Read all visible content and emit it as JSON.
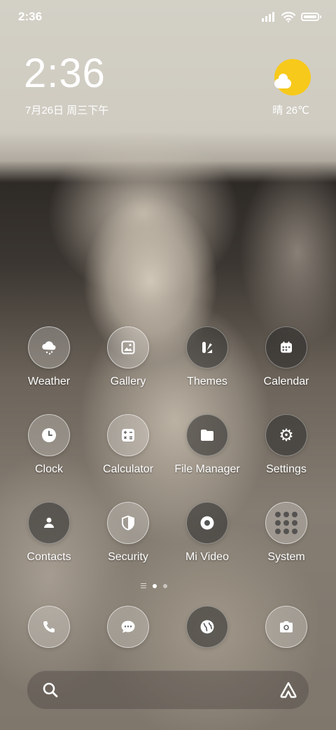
{
  "status_bar": {
    "time": "2:36"
  },
  "lock_widget": {
    "time": "2:36",
    "date": "7月26日 周三下午",
    "weather": "晴 26℃"
  },
  "apps": [
    {
      "label": "Weather",
      "icon": "weather-cloud-icon"
    },
    {
      "label": "Gallery",
      "icon": "gallery-icon"
    },
    {
      "label": "Themes",
      "icon": "themes-icon"
    },
    {
      "label": "Calendar",
      "icon": "calendar-icon"
    },
    {
      "label": "Clock",
      "icon": "clock-icon"
    },
    {
      "label": "Calculator",
      "icon": "calculator-icon"
    },
    {
      "label": "File Manager",
      "icon": "folder-icon"
    },
    {
      "label": "Settings",
      "icon": "gear-icon"
    },
    {
      "label": "Contacts",
      "icon": "contacts-icon"
    },
    {
      "label": "Security",
      "icon": "shield-icon"
    },
    {
      "label": "Mi Video",
      "icon": "video-play-icon"
    },
    {
      "label": "System",
      "icon": "folder-grid-icon"
    }
  ],
  "dock": [
    {
      "icon": "phone-icon"
    },
    {
      "icon": "message-icon"
    },
    {
      "icon": "browser-globe-icon"
    },
    {
      "icon": "camera-icon"
    }
  ],
  "page_indicator": {
    "pages": 2,
    "current": 1
  },
  "colors": {
    "sun": "#f7c91b",
    "icon_bg": "rgba(255,255,255,0.22)"
  }
}
